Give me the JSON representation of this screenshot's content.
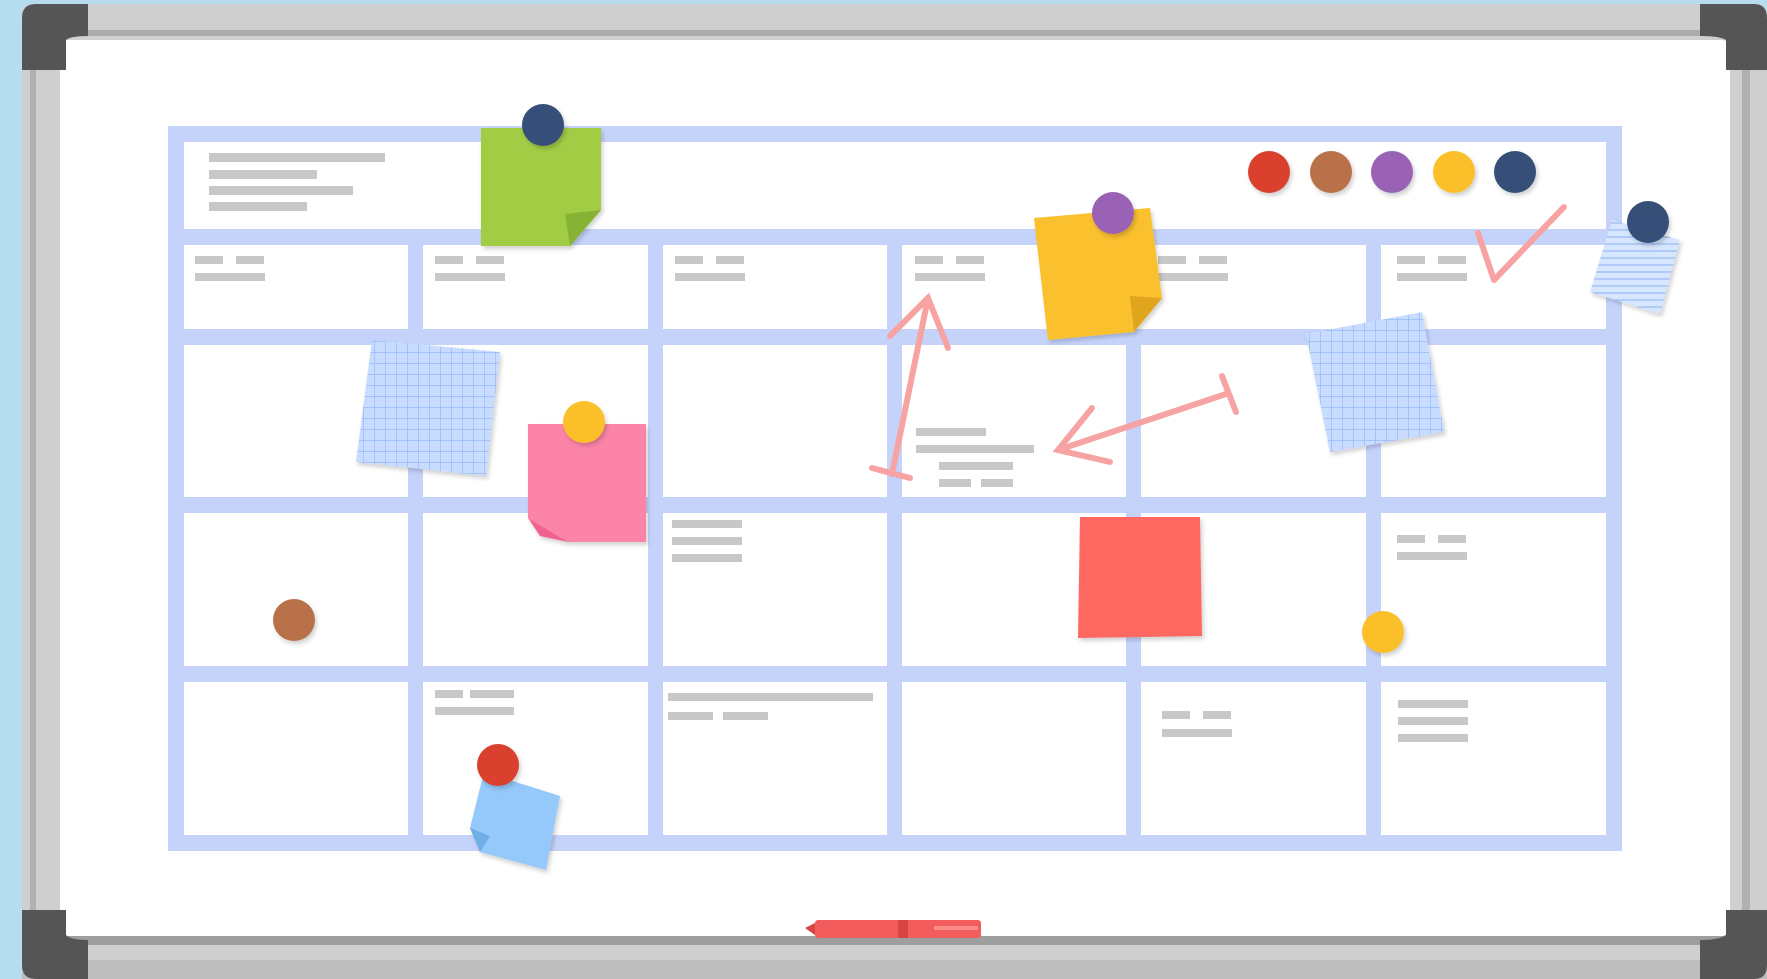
{
  "scene": "whiteboard-calendar",
  "colors": {
    "background": "#b6dcef",
    "frame_light": "#cfcfcf",
    "frame_dark": "#9e9e9e",
    "corner": "#555555",
    "board": "#ffffff",
    "grid": "#c5d3fb",
    "text_line": "#c8c8c8",
    "arrow": "#f7a3a3"
  },
  "magnet_palette": [
    {
      "name": "red-magnet",
      "color": "#d9412e"
    },
    {
      "name": "brown-magnet",
      "color": "#b8714a"
    },
    {
      "name": "purple-magnet",
      "color": "#9a62b5"
    },
    {
      "name": "yellow-magnet",
      "color": "#fbbf2c"
    },
    {
      "name": "navy-magnet",
      "color": "#355079"
    }
  ],
  "sticky_notes": [
    {
      "name": "green-sticky-note",
      "color": "#a3cc45"
    },
    {
      "name": "yellow-sticky-note",
      "color": "#fbc02d"
    },
    {
      "name": "pink-sticky-note",
      "color": "#fd84a9"
    },
    {
      "name": "red-sticky-note",
      "color": "#fe6861"
    },
    {
      "name": "blue-sticky-note",
      "color": "#95c9fb"
    },
    {
      "name": "grid-paper-note",
      "color": "#c7dcfe"
    }
  ],
  "marker": {
    "color": "#f25c5c"
  }
}
